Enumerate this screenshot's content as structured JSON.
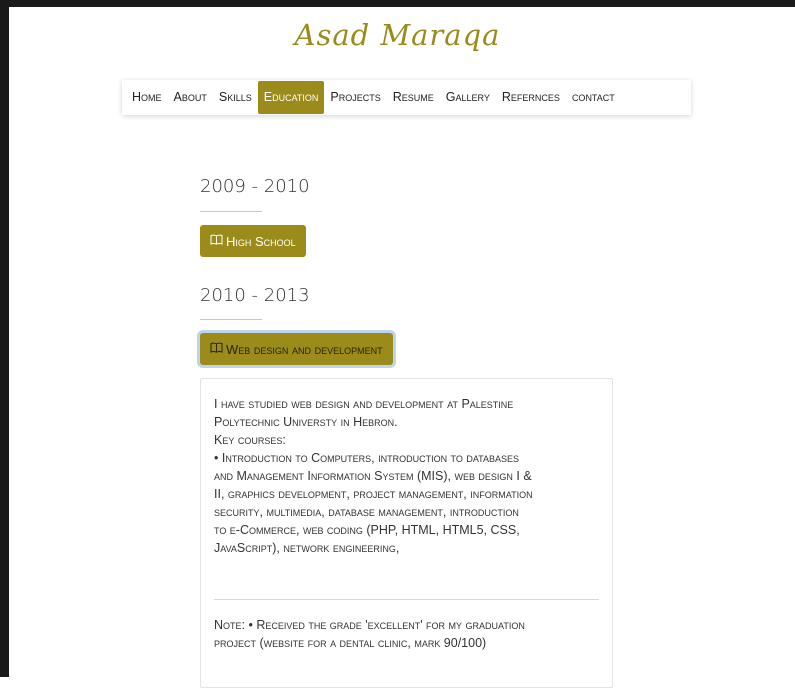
{
  "site": {
    "logo": "Asad Maraqa"
  },
  "nav": {
    "items": [
      {
        "label": "Home"
      },
      {
        "label": "About"
      },
      {
        "label": "Skills"
      },
      {
        "label": "Education"
      },
      {
        "label": "Projects"
      },
      {
        "label": "Resume"
      },
      {
        "label": "Gallery"
      },
      {
        "label": "Refernces"
      },
      {
        "label": "contact"
      }
    ],
    "active": "Education"
  },
  "education": [
    {
      "years": "2009 - 2010",
      "title": "High School"
    },
    {
      "years": "2010 - 2013",
      "title": "Web design and development"
    }
  ],
  "details": {
    "lines": [
      "I have studied web design and development at Palestine",
      "Polytechnic Universty in Hebron.",
      "Key courses:",
      "• Introduction to Computers, introduction to databases",
      "and Management Information System (MIS), web design I &",
      "II, graphics development, project management, information",
      "security, multimedia, database management, introduction",
      "to e-Commerce, web coding (PHP, HTML, HTML5, CSS,",
      "JavaScript), network engineering,"
    ],
    "note_lines": [
      "Note: • Received the grade 'excellent' for my graduation",
      "project (website for a dental clinic, mark 90/100)"
    ]
  },
  "icons": {
    "book": "book-icon"
  },
  "colors": {
    "accent": "#9a8b1a",
    "focus_ring": "#bcd5ec"
  }
}
